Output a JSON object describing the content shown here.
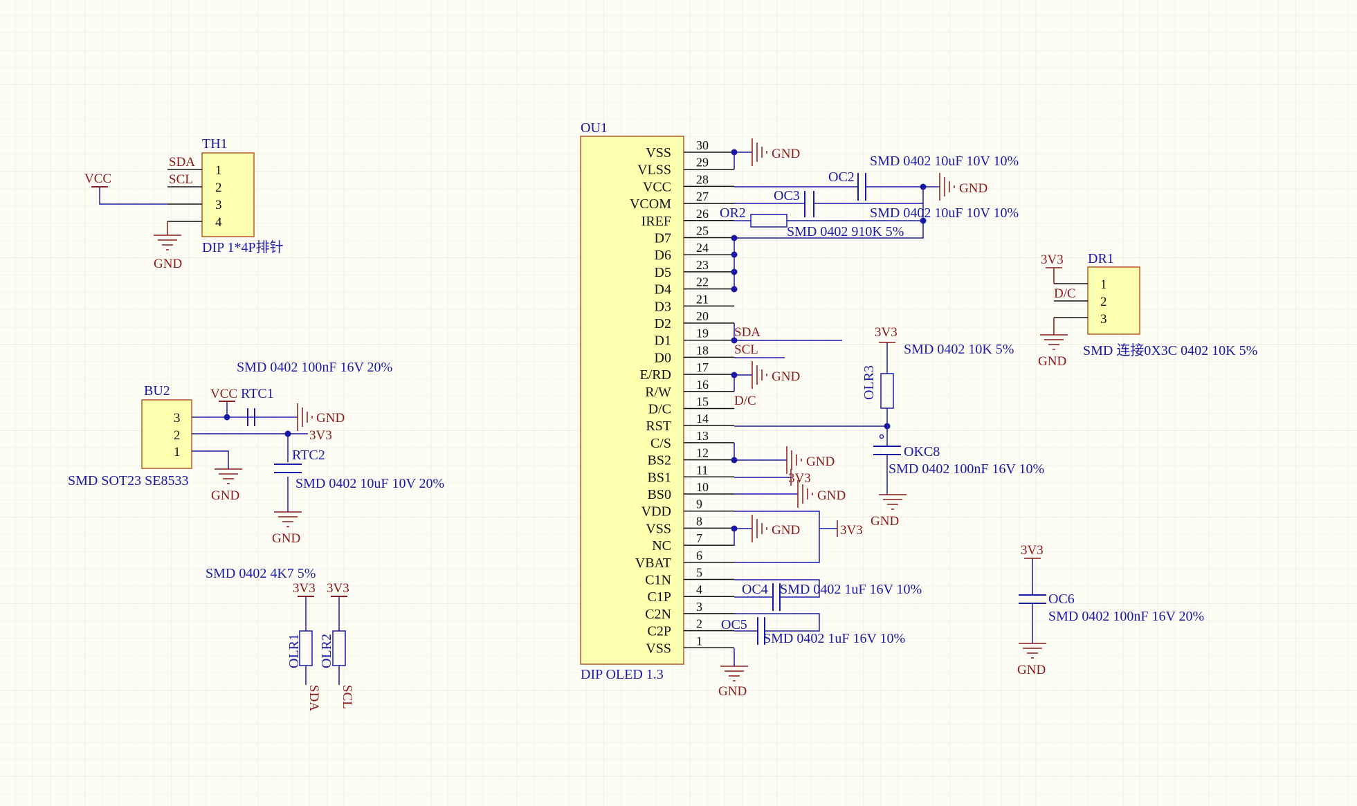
{
  "colors": {
    "background": "#fcfbf4",
    "grid": "#e9e7dc",
    "component_fill": "#ffffb0",
    "component_border": "#b35a2a",
    "wire": "#1a1aa6",
    "net_label": "#8b1a1a",
    "designator": "#1a1aa6",
    "pin_text": "#111111"
  },
  "ou1": {
    "designator": "OU1",
    "comment": "DIP OLED 1.3",
    "pins": [
      {
        "name": "VSS",
        "num": "30"
      },
      {
        "name": "VLSS",
        "num": "29"
      },
      {
        "name": "VCC",
        "num": "28"
      },
      {
        "name": "VCOM",
        "num": "27"
      },
      {
        "name": "IREF",
        "num": "26"
      },
      {
        "name": "D7",
        "num": "25"
      },
      {
        "name": "D6",
        "num": "24"
      },
      {
        "name": "D5",
        "num": "23"
      },
      {
        "name": "D4",
        "num": "22"
      },
      {
        "name": "D3",
        "num": "21"
      },
      {
        "name": "D2",
        "num": "20"
      },
      {
        "name": "D1",
        "num": "19"
      },
      {
        "name": "D0",
        "num": "18"
      },
      {
        "name": "E/RD",
        "num": "17"
      },
      {
        "name": "R/W",
        "num": "16"
      },
      {
        "name": "D/C",
        "num": "15"
      },
      {
        "name": "RST",
        "num": "14"
      },
      {
        "name": "C/S",
        "num": "13"
      },
      {
        "name": "BS2",
        "num": "12"
      },
      {
        "name": "BS1",
        "num": "11"
      },
      {
        "name": "BS0",
        "num": "10"
      },
      {
        "name": "VDD",
        "num": "9"
      },
      {
        "name": "VSS",
        "num": "8"
      },
      {
        "name": "NC",
        "num": "7"
      },
      {
        "name": "VBAT",
        "num": "6"
      },
      {
        "name": "C1N",
        "num": "5"
      },
      {
        "name": "C1P",
        "num": "4"
      },
      {
        "name": "C2N",
        "num": "3"
      },
      {
        "name": "C2P",
        "num": "2"
      },
      {
        "name": "VSS",
        "num": "1"
      }
    ]
  },
  "th1": {
    "designator": "TH1",
    "comment": "DIP 1*4P排针",
    "pins": [
      "1",
      "2",
      "3",
      "4"
    ],
    "net_sda": "SDA",
    "net_scl": "SCL",
    "net_vcc": "VCC",
    "net_gnd": "GND"
  },
  "dr1": {
    "designator": "DR1",
    "comment": "SMD 连接0X3C 0402 10K 5%",
    "pins": [
      "1",
      "2",
      "3"
    ],
    "net_3v3": "3V3",
    "net_dc": "D/C",
    "net_gnd": "GND"
  },
  "bu2": {
    "designator": "BU2",
    "comment": "SMD SOT23 SE8533",
    "pins": [
      "3",
      "2",
      "1"
    ],
    "net_vcc": "VCC",
    "net_gnd": "GND",
    "rtc1_designator": "RTC1",
    "rtc1_comment": "SMD 0402 100nF 16V 20%",
    "rtc1_gnd": "GND",
    "net_3v3": "3V3",
    "rtc2_designator": "RTC2",
    "rtc2_comment": "SMD 0402 10uF 10V 20%",
    "rtc2_gnd": "GND"
  },
  "pullups": {
    "comment": "SMD 0402 4K7 5%",
    "olr1_designator": "OLR1",
    "olr2_designator": "OLR2",
    "olr1_net_top": "3V3",
    "olr2_net_top": "3V3",
    "olr1_net_bottom": "SDA",
    "olr2_net_bottom": "SCL"
  },
  "ou1_nets": {
    "gnd_vss": "GND",
    "gnd_vcc": "GND",
    "oc2_designator": "OC2",
    "oc2_comment": "SMD 0402 10uF 10V 10%",
    "oc3_designator": "OC3",
    "oc3_comment": "SMD 0402 10uF 10V 10%",
    "or2_designator": "OR2",
    "or2_comment": "SMD 0402 910K 5%",
    "sda": "SDA",
    "scl": "SCL",
    "gnd_erd": "GND",
    "dc": "D/C",
    "olr3_designator": "OLR3",
    "olr3_comment": "SMD 0402 10K 5%",
    "olr3_3v3": "3V3",
    "okc8_designator": "OKC8",
    "okc8_comment": "SMD 0402 100nF 16V 10%",
    "okc8_gnd": "GND",
    "gnd_bs2": "GND",
    "v3v3_bs1": "3V3",
    "gnd_bs0": "GND",
    "gnd_vss8": "GND",
    "v3v3_vdd": "3V3",
    "oc4_designator": "OC4",
    "oc4_comment": "SMD 0402 1uF 16V 10%",
    "oc5_designator": "OC5",
    "oc5_comment": "SMD 0402 1uF 16V 10%",
    "gnd_vss1": "GND"
  },
  "oc6": {
    "designator": "OC6",
    "comment": "SMD 0402 100nF 16V 20%",
    "net_3v3": "3V3",
    "net_gnd": "GND"
  }
}
